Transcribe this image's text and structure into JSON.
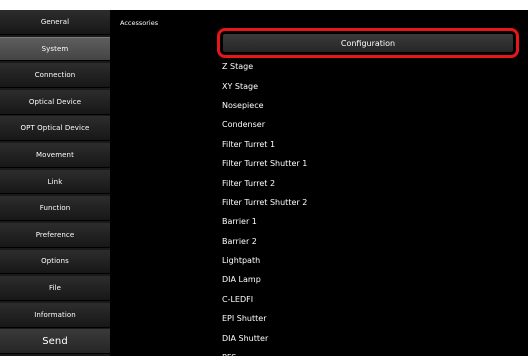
{
  "sidebar": {
    "items": [
      {
        "label": "General"
      },
      {
        "label": "System"
      },
      {
        "label": "Connection"
      },
      {
        "label": "Optical Device"
      },
      {
        "label": "OPT Optical Device"
      },
      {
        "label": "Movement"
      },
      {
        "label": "Link"
      },
      {
        "label": "Function"
      },
      {
        "label": "Preference"
      },
      {
        "label": "Options"
      },
      {
        "label": "File"
      },
      {
        "label": "Information"
      }
    ],
    "active": "System",
    "send_label": "Send"
  },
  "main": {
    "section_label": "Accessories",
    "config_button_label": "Configuration",
    "highlight_color": "#e8161b",
    "accessories": [
      "Z Stage",
      "XY Stage",
      "Nosepiece",
      "Condenser",
      "Filter Turret 1",
      "Filter Turret Shutter 1",
      "Filter Turret 2",
      "Filter Turret Shutter 2",
      "Barrier 1",
      "Barrier 2",
      "Lightpath",
      "DIA Lamp",
      "C-LEDFI",
      "EPI Shutter",
      "DIA Shutter",
      "PFS"
    ]
  }
}
